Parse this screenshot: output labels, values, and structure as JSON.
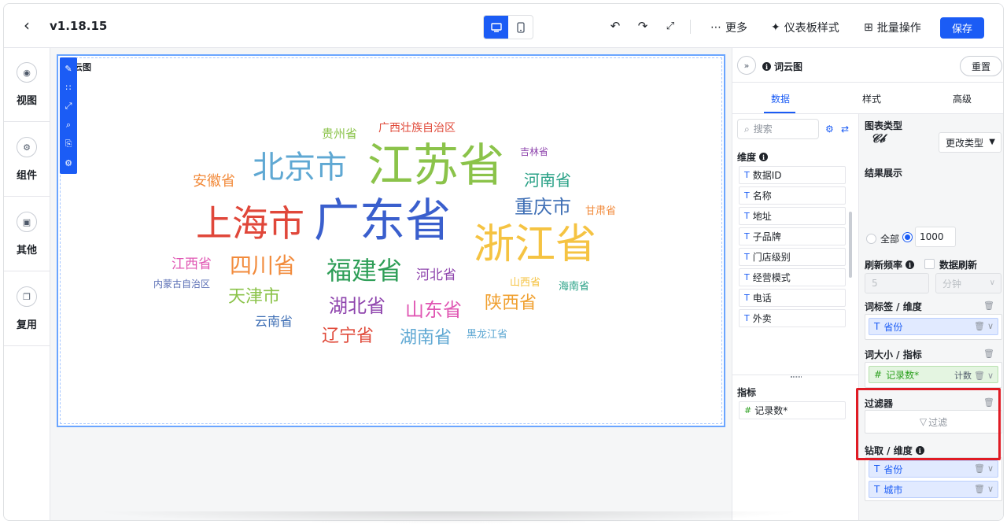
{
  "header": {
    "version": "v1.18.15",
    "more_label": "更多",
    "dashboard_style_label": "仪表板样式",
    "batch_label": "批量操作",
    "save_label": "保存"
  },
  "leftrail": {
    "items": [
      {
        "label": "视图"
      },
      {
        "label": "组件"
      },
      {
        "label": "其他"
      },
      {
        "label": "复用"
      }
    ]
  },
  "widget": {
    "title": "云图"
  },
  "chart_data": {
    "type": "wordcloud",
    "words": [
      {
        "text": "江苏省",
        "color": "#8bc34a"
      },
      {
        "text": "广东省",
        "color": "#3a5fcd"
      },
      {
        "text": "浙江省",
        "color": "#f5c342"
      },
      {
        "text": "上海市",
        "color": "#e0473a"
      },
      {
        "text": "北京市",
        "color": "#5fa8d3"
      },
      {
        "text": "福建省",
        "color": "#2e9e57"
      },
      {
        "text": "四川省",
        "color": "#f28b3c"
      },
      {
        "text": "重庆市",
        "color": "#3f6fb5"
      },
      {
        "text": "湖北省",
        "color": "#8e44ad"
      },
      {
        "text": "山东省",
        "color": "#e056b3"
      },
      {
        "text": "河南省",
        "color": "#27a085"
      },
      {
        "text": "陕西省",
        "color": "#f0a030"
      },
      {
        "text": "天津市",
        "color": "#8bc34a"
      },
      {
        "text": "辽宁省",
        "color": "#e04a3a"
      },
      {
        "text": "湖南省",
        "color": "#5fa8d3"
      },
      {
        "text": "安徽省",
        "color": "#f28b3c"
      },
      {
        "text": "河北省",
        "color": "#8e44ad"
      },
      {
        "text": "江西省",
        "color": "#e056b3"
      },
      {
        "text": "云南省",
        "color": "#3f6fb5"
      },
      {
        "text": "贵州省",
        "color": "#8bc34a"
      },
      {
        "text": "广西壮族自治区",
        "color": "#e04a3a"
      },
      {
        "text": "甘肃省",
        "color": "#f28b3c"
      },
      {
        "text": "吉林省",
        "color": "#8e44ad"
      },
      {
        "text": "山西省",
        "color": "#f5c342"
      },
      {
        "text": "海南省",
        "color": "#27a085"
      },
      {
        "text": "内蒙古自治区",
        "color": "#5b6fb5"
      },
      {
        "text": "黑龙江省",
        "color": "#5fa8d3"
      }
    ]
  },
  "panel": {
    "title": "词云图",
    "reset_label": "重置",
    "tabs": [
      {
        "label": "数据"
      },
      {
        "label": "样式"
      },
      {
        "label": "高级"
      }
    ],
    "search_placeholder": "搜索",
    "dimension_label": "维度",
    "dimensions": [
      {
        "label": "数据ID"
      },
      {
        "label": "名称"
      },
      {
        "label": "地址"
      },
      {
        "label": "子品牌"
      },
      {
        "label": "门店级别"
      },
      {
        "label": "经营模式"
      },
      {
        "label": "电话"
      },
      {
        "label": "外卖"
      }
    ],
    "measure_label": "指标",
    "measures": [
      {
        "label": "记录数*"
      }
    ],
    "chart_type_label": "图表类型",
    "change_type_label": "更改类型",
    "result_label": "结果展示",
    "all_label": "全部",
    "limit_value": "1000",
    "refresh_label": "刷新频率",
    "data_refresh_label": "数据刷新",
    "refresh_value": "5",
    "refresh_unit": "分钟",
    "word_label_section": "词标签 / 维度",
    "word_label_field": "省份",
    "word_size_section": "词大小 / 指标",
    "word_size_field": "记录数*",
    "word_size_agg": "计数",
    "filter_section": "过滤器",
    "filter_placeholder": "过滤",
    "drill_section": "钻取 / 维度",
    "drill_fields": [
      {
        "label": "省份"
      },
      {
        "label": "城市"
      }
    ]
  }
}
